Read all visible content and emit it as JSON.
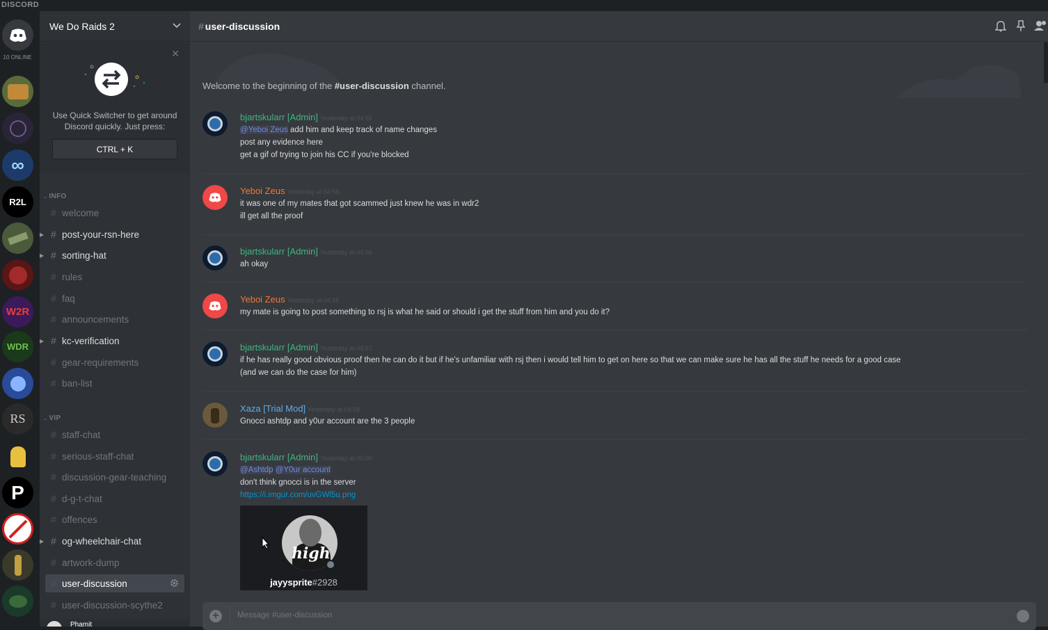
{
  "app": {
    "brand": "DISCORD",
    "online_count": "10 ONLINE"
  },
  "server": {
    "name": "We Do Raids 2"
  },
  "quick_switcher": {
    "text_line1": "Use Quick Switcher to get around",
    "text_line2": "Discord quickly. Just press:",
    "shortcut": "CTRL + K"
  },
  "categories": {
    "info": "INFO",
    "vip": "VIP"
  },
  "channels": {
    "welcome": "welcome",
    "post_your_rsn_here": "post-your-rsn-here",
    "sorting_hat": "sorting-hat",
    "rules": "rules",
    "faq": "faq",
    "announcements": "announcements",
    "kc_verification": "kc-verification",
    "gear_requirements": "gear-requirements",
    "ban_list": "ban-list",
    "staff_chat": "staff-chat",
    "serious_staff_chat": "serious-staff-chat",
    "discussion_gear_teaching": "discussion-gear-teaching",
    "d_g_t_chat": "d-g-t-chat",
    "offences": "offences",
    "og_wheelchair_chat": "og-wheelchair-chat",
    "artwork_dump": "artwork-dump",
    "user_discussion": "user-discussion",
    "user_discussion_scythe2": "user-discussion-scythe2"
  },
  "guild_labels": {
    "r2l": "R2L",
    "rs": "RS"
  },
  "channel_header": {
    "name": "user-discussion"
  },
  "welcome": {
    "prefix": "Welcome to the beginning of the ",
    "channel": "#user-discussion",
    "suffix": " channel."
  },
  "messages": [
    {
      "author": "bjartskularr [Admin]",
      "timestamp": "Yesterday at 04:55",
      "mention": "@Yeboi Zeus",
      "line1_rest": " add him and keep track of name changes",
      "line2": "post any evidence here",
      "line3": "get a gif of trying to join his CC if you're blocked"
    },
    {
      "author": "Yeboi Zeus",
      "timestamp": "Yesterday at 04:55",
      "line1": "it was one of my mates that got scammed just knew he was in wdr2",
      "line2": "ill get all the proof"
    },
    {
      "author": "bjartskularr [Admin]",
      "timestamp": "Yesterday at 04:56",
      "line1": "ah okay"
    },
    {
      "author": "Yeboi Zeus",
      "timestamp": "Yesterday at 04:56",
      "line1": "my mate is going to post something to rsj is what he said or should i get the stuff from him and you do it?"
    },
    {
      "author": "bjartskularr [Admin]",
      "timestamp": "Yesterday at 04:57",
      "line1": "if he has really good obvious proof then he can do it but if he's unfamiliar with rsj then i would tell him to get on here so that we can make sure he has all the stuff he needs for a good case",
      "line2": "(and we can do the case for him)"
    },
    {
      "author": "Xaza [Trial Mod]",
      "timestamp": "Yesterday at 04:58",
      "line1": "Gnocci ashtdp and y0ur account are the 3 people"
    },
    {
      "author": "bjartskularr [Admin]",
      "timestamp": "Yesterday at 05:00",
      "mention1": "@Ashtdp",
      "mention2": "@Y0ur account",
      "line2": "don't think gnocci is in the server",
      "link": "https://i.imgur.com/uvGWl5u.png",
      "embed_name": "jayysprite",
      "embed_tag": "#2928",
      "embed_avatar_text": "high"
    }
  ],
  "composer": {
    "placeholder": "Message #user-discussion"
  },
  "user_panel": {
    "name": "Phamit"
  },
  "colors": {
    "admin": "#43b581",
    "zeus": "#f57731",
    "mod": "#5dadec",
    "mention": "#7289da",
    "link": "#0096cf",
    "background": "#36393e",
    "sidebar": "#2e3136"
  }
}
